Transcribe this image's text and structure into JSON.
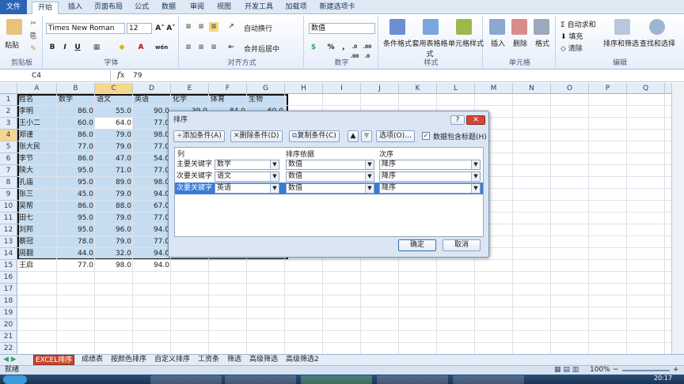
{
  "ribbon_tabs": [
    "文件",
    "开始",
    "插入",
    "页面布局",
    "公式",
    "数据",
    "审阅",
    "视图",
    "开发工具",
    "加载项",
    "新建选项卡"
  ],
  "ribbon": {
    "clipboard": {
      "paste": "粘贴",
      "label": "剪贴板"
    },
    "font": {
      "name": "Times New Roman",
      "size": "12",
      "bold": "B",
      "italic": "I",
      "underline": "U",
      "label": "字体",
      "grow": "A˄",
      "shrink": "A˅",
      "wen": "wén"
    },
    "alignment": {
      "wrap": "自动换行",
      "merge": "合并后居中",
      "label": "对齐方式"
    },
    "number": {
      "format": "数值",
      "percent": "%",
      "comma": ",",
      "label": "数字",
      "dec_inc": ".0 .00",
      "dec_dec": ".00 .0"
    },
    "styles": {
      "conditional": "条件格式",
      "table": "套用表格格式",
      "cell": "单元格样式",
      "label": "样式"
    },
    "cells": {
      "insert": "插入",
      "delete": "删除",
      "format": "格式",
      "label": "单元格"
    },
    "editing": {
      "autosum": "自动求和",
      "fill": "填充",
      "clear": "清除",
      "sort": "排序和筛选",
      "find": "查找和选择",
      "label": "编辑"
    }
  },
  "formula_bar": {
    "name_box": "C4",
    "fx": "fx",
    "value": "79"
  },
  "columns": [
    "A",
    "B",
    "C",
    "D",
    "E",
    "F",
    "G",
    "H",
    "I",
    "J",
    "K",
    "L",
    "M",
    "N",
    "O",
    "P",
    "Q"
  ],
  "rows": [
    "1",
    "2",
    "3",
    "4",
    "5",
    "6",
    "7",
    "8",
    "9",
    "10",
    "11",
    "12",
    "13",
    "14",
    "15",
    "16",
    "17",
    "18",
    "19",
    "20",
    "21",
    "22"
  ],
  "table": {
    "headers": [
      "姓名",
      "数学",
      "语文",
      "英语",
      "化学",
      "体育",
      "生物"
    ],
    "partial_row1": [
      "39.0",
      "84.0",
      "60.0"
    ],
    "rows": [
      [
        "李明",
        "86.0",
        "55.0",
        "90.0"
      ],
      [
        "王小二",
        "60.0",
        "64.0",
        "77.0"
      ],
      [
        "郑谨",
        "86.0",
        "79.0",
        "98.0"
      ],
      [
        "张大民",
        "77.0",
        "79.0",
        "77.0"
      ],
      [
        "李节",
        "86.0",
        "47.0",
        "54.0"
      ],
      [
        "陕大",
        "95.0",
        "71.0",
        "77.0"
      ],
      [
        "孔庙",
        "95.0",
        "89.0",
        "98.0"
      ],
      [
        "张三",
        "45.0",
        "79.0",
        "94.0"
      ],
      [
        "吴帮",
        "86.0",
        "88.0",
        "67.0"
      ],
      [
        "田七",
        "95.0",
        "79.0",
        "77.0"
      ],
      [
        "刘邦",
        "95.0",
        "96.0",
        "94.0"
      ],
      [
        "蔡冠",
        "78.0",
        "79.0",
        "77.0"
      ],
      [
        "周翻",
        "44.0",
        "32.0",
        "94.0"
      ],
      [
        "王启",
        "77.0",
        "98.0",
        "94.0"
      ]
    ]
  },
  "sheet_tabs": [
    "EXCEL排序",
    "成绩表",
    "按颜色排序",
    "自定义排序",
    "工资条",
    "筛选",
    "高级筛选",
    "高级筛选2"
  ],
  "status": {
    "ready": "就绪",
    "zoom": "100%",
    "minus": "−",
    "plus": "+"
  },
  "dialog": {
    "title": "排序",
    "help": "?",
    "close": "✕",
    "add_level": "添加条件(A)",
    "delete_level": "删除条件(D)",
    "copy_level": "复制条件(C)",
    "options": "选项(O)...",
    "has_headers": "数据包含标题(H)",
    "col_header": "列",
    "sort_on_header": "排序依据",
    "order_header": "次序",
    "levels": [
      {
        "key": "主要关键字",
        "column": "数学",
        "sort_on": "数值",
        "order": "降序"
      },
      {
        "key": "次要关键字",
        "column": "语文",
        "sort_on": "数值",
        "order": "降序"
      },
      {
        "key": "次要关键字",
        "column": "英语",
        "sort_on": "数值",
        "order": "降序"
      }
    ],
    "ok": "确定",
    "cancel": "取消"
  },
  "taskbar": {
    "clock": "20:17"
  },
  "colors": {
    "accent": "#2a64b7",
    "selection": "#c6dcf0",
    "sheet_tab_active": "#c8472c",
    "dialog_row_selected": "#3a7bd5"
  }
}
